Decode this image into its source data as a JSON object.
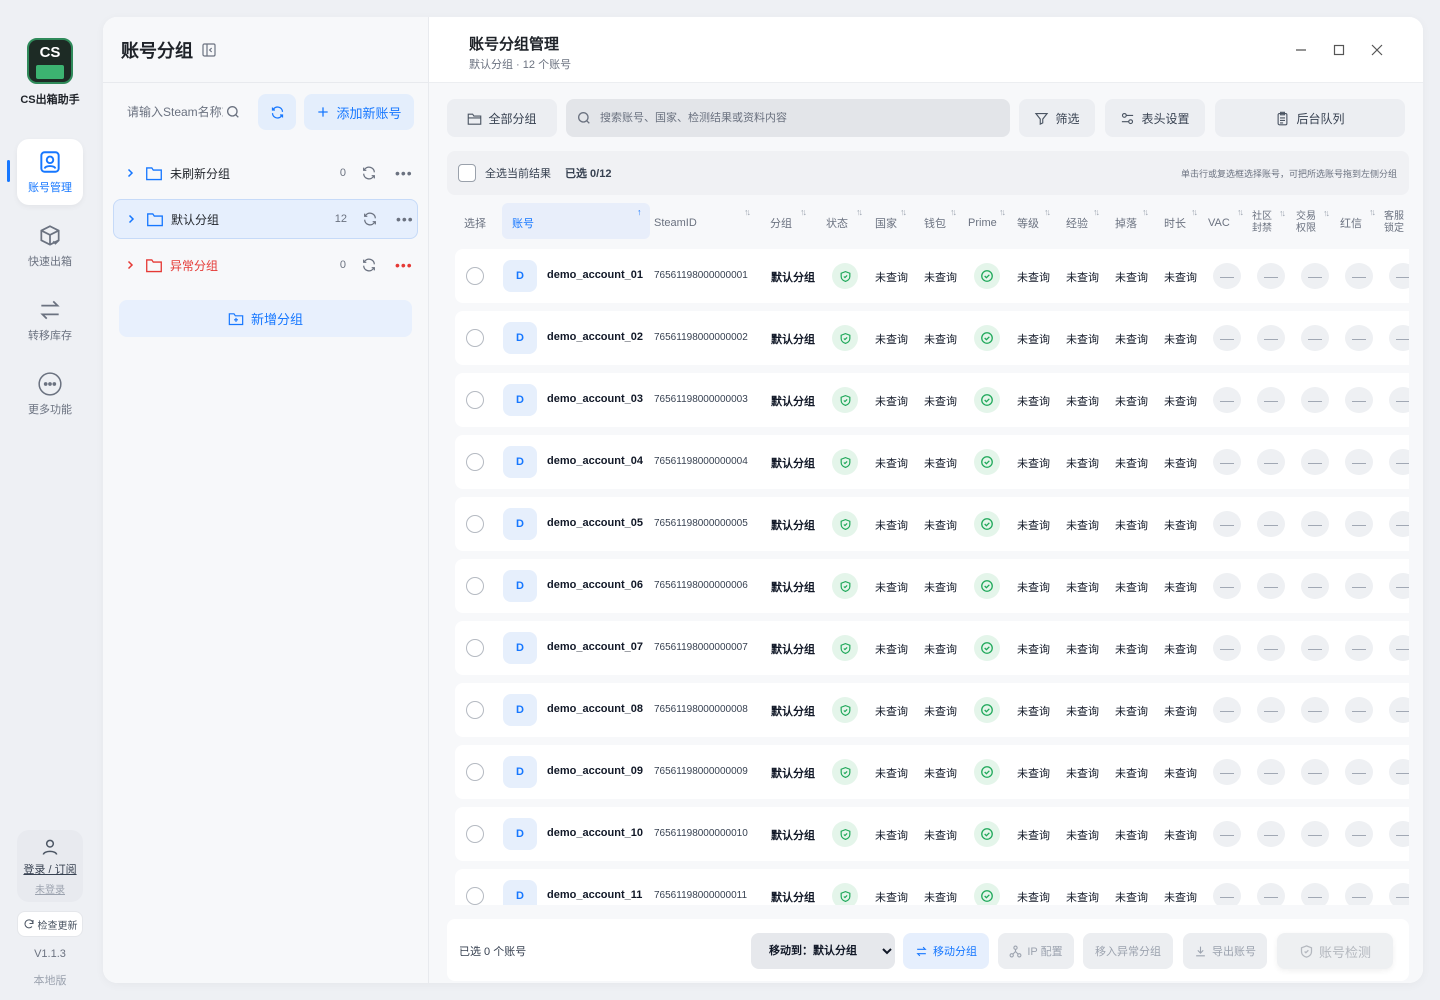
{
  "app": {
    "logo_text": "CS",
    "name": "CS出箱助手"
  },
  "rail": {
    "items": [
      {
        "label": "账号管理",
        "icon": "account-manage-icon",
        "active": true
      },
      {
        "label": "快速出箱",
        "icon": "box-icon",
        "active": false
      },
      {
        "label": "转移库存",
        "icon": "transfer-icon",
        "active": false
      },
      {
        "label": "更多功能",
        "icon": "more-icon",
        "active": false
      }
    ],
    "login_label": "登录 / 订阅",
    "login_status": "未登录",
    "update_label": "检查更新",
    "version": "V1.1.3",
    "edition": "本地版"
  },
  "groups_panel": {
    "title": "账号分组",
    "search_placeholder": "请输入Steam名称或账号",
    "add_account_label": "添加新账号",
    "groups": [
      {
        "name": "未刷新分组",
        "count": "0",
        "selected": false,
        "error": false
      },
      {
        "name": "默认分组",
        "count": "12",
        "selected": true,
        "error": false
      },
      {
        "name": "异常分组",
        "count": "0",
        "selected": false,
        "error": true
      }
    ],
    "new_group_label": "新增分组"
  },
  "main": {
    "title": "账号分组管理",
    "subtitle": "默认分组 · 12 个账号",
    "toolbar": {
      "all_groups": "全部分组",
      "search_placeholder": "搜索账号、国家、检测结果或资料内容",
      "filter": "筛选",
      "header_settings": "表头设置",
      "queue": "后台队列"
    },
    "select_all_label": "全选当前结果",
    "selected_count": "已选 0/12",
    "hint": "单击行或复选框选择账号，可把所选账号拖到左侧分组",
    "columns": {
      "select": "选择",
      "account": "账号",
      "steamid": "SteamID",
      "group": "分组",
      "status": "状态",
      "country": "国家",
      "wallet": "钱包",
      "prime": "Prime",
      "level": "等级",
      "exp": "经验",
      "drop": "掉落",
      "hours": "时长",
      "vac": "VAC",
      "community_ban_1": "社区",
      "community_ban_2": "封禁",
      "trade_limit_1": "交易",
      "trade_limit_2": "权限",
      "red_letter": "红信",
      "support_lock_1": "客服",
      "support_lock_2": "锁定"
    },
    "unqueried": "未查询",
    "dash": "—",
    "rows": [
      {
        "avatar": "D",
        "account": "demo_account_01",
        "steamid": "76561198000000001",
        "group": "默认分组"
      },
      {
        "avatar": "D",
        "account": "demo_account_02",
        "steamid": "76561198000000002",
        "group": "默认分组"
      },
      {
        "avatar": "D",
        "account": "demo_account_03",
        "steamid": "76561198000000003",
        "group": "默认分组"
      },
      {
        "avatar": "D",
        "account": "demo_account_04",
        "steamid": "76561198000000004",
        "group": "默认分组"
      },
      {
        "avatar": "D",
        "account": "demo_account_05",
        "steamid": "76561198000000005",
        "group": "默认分组"
      },
      {
        "avatar": "D",
        "account": "demo_account_06",
        "steamid": "76561198000000006",
        "group": "默认分组"
      },
      {
        "avatar": "D",
        "account": "demo_account_07",
        "steamid": "76561198000000007",
        "group": "默认分组"
      },
      {
        "avatar": "D",
        "account": "demo_account_08",
        "steamid": "76561198000000008",
        "group": "默认分组"
      },
      {
        "avatar": "D",
        "account": "demo_account_09",
        "steamid": "76561198000000009",
        "group": "默认分组"
      },
      {
        "avatar": "D",
        "account": "demo_account_10",
        "steamid": "76561198000000010",
        "group": "默认分组"
      },
      {
        "avatar": "D",
        "account": "demo_account_11",
        "steamid": "76561198000000011",
        "group": "默认分组"
      }
    ],
    "footer": {
      "selected": "已选 0 个账号",
      "move_to_value": "移动到：默认分组",
      "move_group": "移动分组",
      "ip_config": "IP 配置",
      "move_to_error": "移入异常分组",
      "export": "导出账号",
      "detect": "账号检测"
    }
  },
  "colors": {
    "accent": "#1677ff",
    "success": "#1fa85a",
    "danger": "#e53935"
  }
}
